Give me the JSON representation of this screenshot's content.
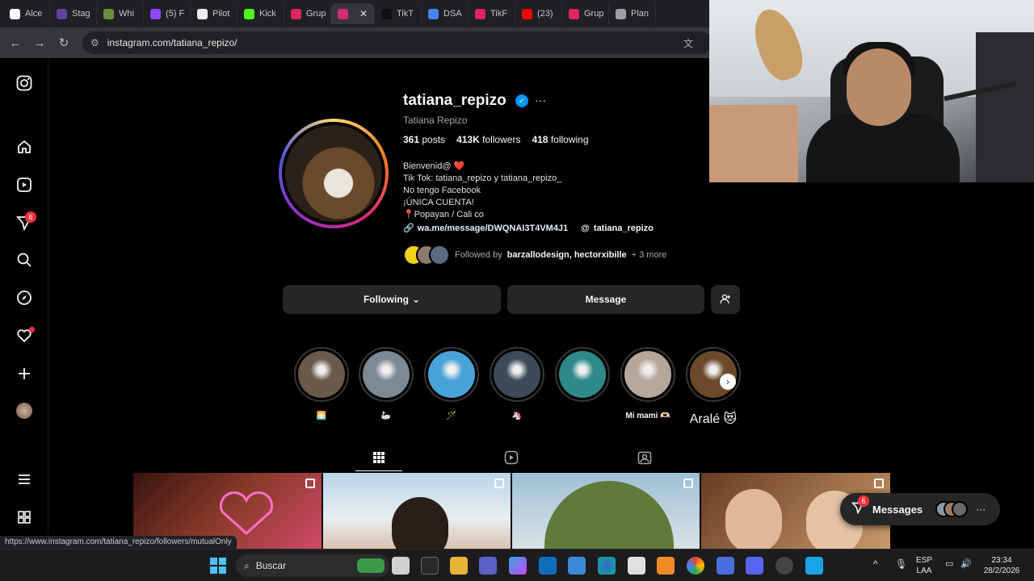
{
  "browser": {
    "tabs": [
      {
        "label": "Alce",
        "color": "#ffffff"
      },
      {
        "label": "Stag",
        "color": "#6441a5"
      },
      {
        "label": "Whi",
        "color": "#6b8f3a"
      },
      {
        "label": "(5) F",
        "color": "#9146ff"
      },
      {
        "label": "Pilot",
        "color": "#eeeeee"
      },
      {
        "label": "Kick",
        "color": "#53fc18"
      },
      {
        "label": "Grup",
        "color": "#e0245e"
      },
      {
        "label": "",
        "color": "#d62976",
        "active": true
      },
      {
        "label": "TikT",
        "color": "#111111"
      },
      {
        "label": "DSA",
        "color": "#4285f4"
      },
      {
        "label": "TikF",
        "color": "#e0245e"
      },
      {
        "label": "(23)",
        "color": "#ff0000"
      },
      {
        "label": "Grup",
        "color": "#e0245e"
      },
      {
        "label": "Plan",
        "color": "#9aa0a6"
      }
    ],
    "close_glyph": "✕",
    "url": "instagram.com/tatiana_repizo/",
    "status_url": "https://www.instagram.com/tatiana_repizo/followers/mutualOnly"
  },
  "sidebar": {
    "notifications_badge": "6"
  },
  "profile": {
    "username": "tatiana_repizo",
    "full_name": "Tatiana Repizo",
    "posts_count": "361",
    "posts_label": "posts",
    "followers_count": "413K",
    "followers_label": "followers",
    "following_count": "418",
    "following_label": "following",
    "bio": [
      "Bienvenid@ ❤️",
      "Tik Tok: tatiana_repizo y tatiana_repizo_",
      "No tengo Facebook",
      "¡ÚNICA CUENTA!",
      "📍Popayan / Cali co"
    ],
    "link": "wa.me/message/DWQNAI3T4VM4J1",
    "threads_handle": "tatiana_repizo",
    "followed_by_prefix": "Followed by",
    "followed_by_names": "barzallodesign, hectorxibille",
    "followed_by_more": "+ 3 more",
    "following_button": "Following",
    "message_button": "Message"
  },
  "highlights": [
    {
      "label": "🌅",
      "color": "#6a5a4a"
    },
    {
      "label": "🦢",
      "color": "#7c8a96"
    },
    {
      "label": "🪄",
      "color": "#4aa3d8"
    },
    {
      "label": "🦄",
      "color": "#3c4a5a"
    },
    {
      "label": "",
      "color": "#2e8a8a"
    },
    {
      "label": "Mi mami 🫶🏻",
      "color": "#b7a79a"
    },
    {
      "label": "🧿",
      "color": "#3a2218"
    },
    {
      "label": "Aralé 😻",
      "color": "#6a4a2a"
    }
  ],
  "posts": [
    {
      "color": "#6a2a22"
    },
    {
      "color": "#a9c9e2"
    },
    {
      "color": "#8aa6b8"
    },
    {
      "color": "#9a6a4a"
    }
  ],
  "messages_pill": {
    "label": "Messages",
    "badge": "6"
  },
  "taskbar": {
    "search_placeholder": "Buscar",
    "lang_top": "ESP",
    "lang_bottom": "LAA",
    "time": "23:34",
    "date": "28/2/2026"
  }
}
